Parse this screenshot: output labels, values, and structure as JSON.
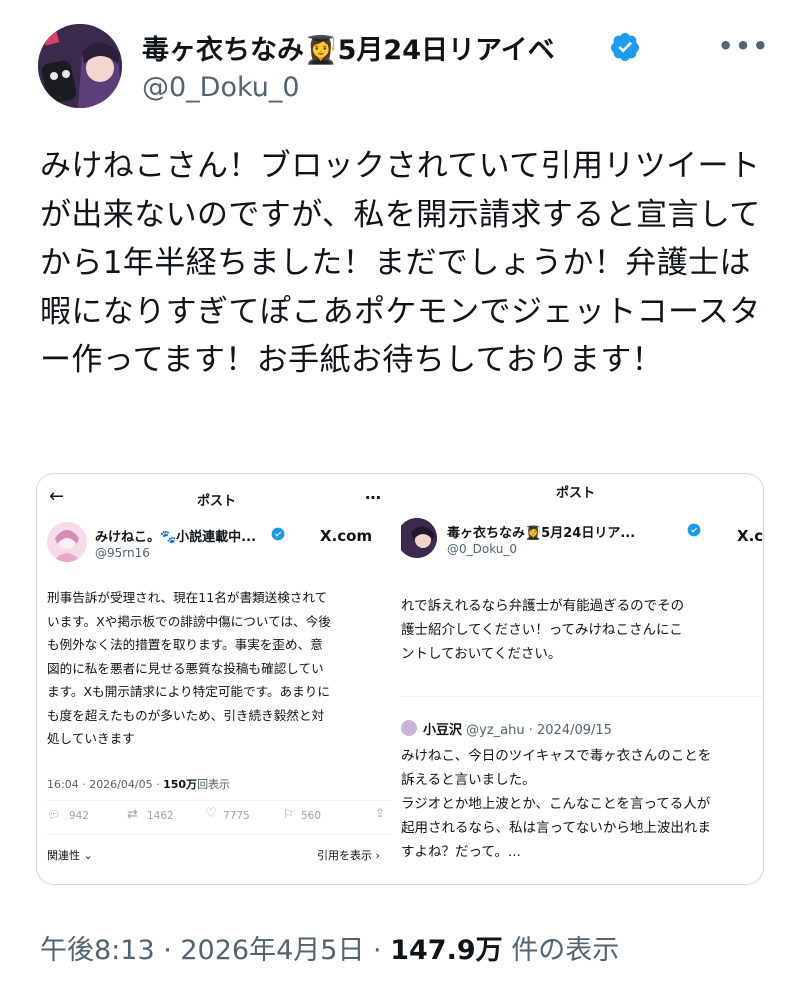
{
  "author": {
    "name": "毒ヶ衣ちなみ👩‍🎓5月24日リアイベ",
    "handle": "@0_Doku_0"
  },
  "tweet": {
    "text": "みけねこさん！ブロックされていて引用リツイートが出来ないのですが、私を開示請求すると宣言してから1年半経ちました！まだでしょうか！弁護士は暇になりすぎてぽこあポケモンでジェットコースター作ってます！お手紙お待ちしております！"
  },
  "left_screenshot": {
    "back": "←",
    "header": "ポスト",
    "more": "…",
    "name": "みけねこ。🐾小説連載中...",
    "handle": "@95rn16",
    "xcom": "X.com",
    "body_lines": [
      "刑事告訴が受理され、現在11名が書類送検されて",
      "います。Xや掲示板での誹謗中傷については、今後",
      "も例外なく法的措置を取ります。事実を歪め、意",
      "図的に私を悪者に見せる悪質な投稿も確認してい",
      "ます。Xも開示請求により特定可能です。あまりに",
      "も度を超えたものが多いため、引き続き毅然と対",
      "処していきます"
    ],
    "meta_time": "16:04 · 2026/04/05 · ",
    "meta_views": "150万",
    "meta_views_suffix": "回表示",
    "replies": "942",
    "reposts": "1462",
    "likes": "7775",
    "bookmarks": "560",
    "relevance": "関連性",
    "quotes": "引用を表示 ›"
  },
  "right_screenshot": {
    "header": "ポスト",
    "name": "毒ヶ衣ちなみ👩‍🎓5月24日リア...",
    "handle": "@0_Doku_0",
    "xcom": "X.com",
    "body_lines": [
      "れで訴えれるなら弁護士が有能過ぎるのでその",
      "護士紹介してください！ってみけねこさんにこ",
      "ントしておいてください。"
    ],
    "reply_name": "小豆沢",
    "reply_meta": "@yz_ahu · 2024/09/15",
    "reply_lines": [
      "みけねこ、今日のツイキャスで毒ヶ衣さんのことを",
      "訴えると言いました。",
      "ラジオとか地上波とか、こんなことを言ってる人が",
      "起用されるなら、私は言ってないから地上波出れま",
      "すよね？だって。..."
    ]
  },
  "footer": {
    "time": "午後8:13 · 2026年4月5日 · ",
    "views": "147.9万",
    "views_label": " 件の表示"
  },
  "colors": {
    "verified": "#1d9bf0",
    "text": "#0f1419",
    "secondary": "#536471",
    "border": "#cfd9de"
  }
}
